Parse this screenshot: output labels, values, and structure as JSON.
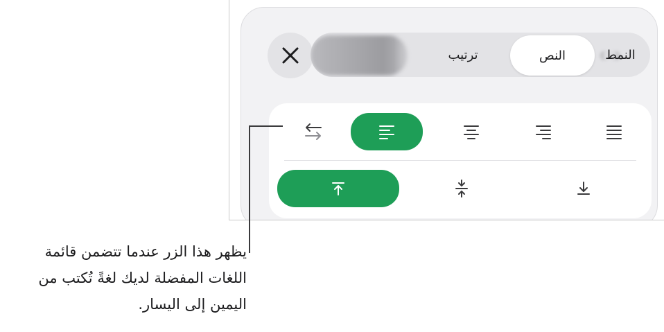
{
  "tabs": {
    "style_label": "النمط",
    "text_label": "النص",
    "arrange_label": "ترتيب"
  },
  "alignment": {
    "active_index": 0,
    "items": [
      {
        "icon": "text-direction-icon"
      },
      {
        "icon": "align-left-icon"
      },
      {
        "icon": "align-center-icon"
      },
      {
        "icon": "align-right-icon"
      },
      {
        "icon": "align-justify-icon"
      }
    ]
  },
  "vertical_alignment": {
    "items": [
      {
        "icon": "align-top-icon"
      },
      {
        "icon": "align-middle-icon"
      },
      {
        "icon": "align-bottom-icon"
      }
    ]
  },
  "callout": {
    "text": "يظهر هذا الزر عندما تتضمن قائمة اللغات المفضلة لديك لغةً تُكتب من اليمين إلى اليسار."
  },
  "colors": {
    "accent": "#1e9e57",
    "panel": "#f2f2f4",
    "segment": "#e3e3e6"
  }
}
